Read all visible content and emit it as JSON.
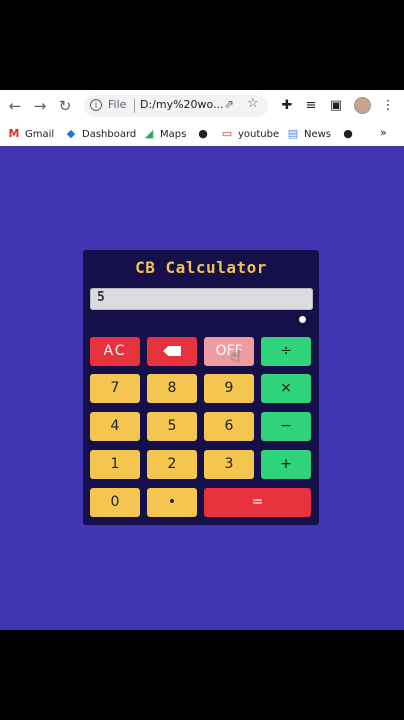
{
  "browser": {
    "omnibox": {
      "file_label": "File",
      "url": "D:/my%20wo..."
    },
    "bookmarks": [
      {
        "label": "Gmail",
        "icon": "gmail-icon"
      },
      {
        "label": "Dashboard",
        "icon": "dashboard-icon"
      },
      {
        "label": "Maps",
        "icon": "maps-icon"
      },
      {
        "label": "",
        "icon": "globe-icon"
      },
      {
        "label": "youtube",
        "icon": "youtube-icon"
      },
      {
        "label": "News",
        "icon": "news-icon"
      },
      {
        "label": "",
        "icon": "globe-icon"
      }
    ],
    "more_label": "»"
  },
  "calculator": {
    "title": "CB Calculator",
    "display_value": "5",
    "keys": {
      "ac": "AC",
      "backspace": "⌫",
      "off": "OFF",
      "divide": "÷",
      "seven": "7",
      "eight": "8",
      "nine": "9",
      "multiply": "×",
      "four": "4",
      "five": "5",
      "six": "6",
      "subtract": "−",
      "one": "1",
      "two": "2",
      "three": "3",
      "add": "+",
      "zero": "0",
      "decimal": "•",
      "equals": "="
    },
    "colors": {
      "background": "#4235b2",
      "panel": "#15104a",
      "title": "#f2c14e",
      "number_key": "#f4c54f",
      "operator_key": "#2fd47a",
      "danger_key": "#e8323e",
      "off_key": "#ef9ba2"
    }
  }
}
